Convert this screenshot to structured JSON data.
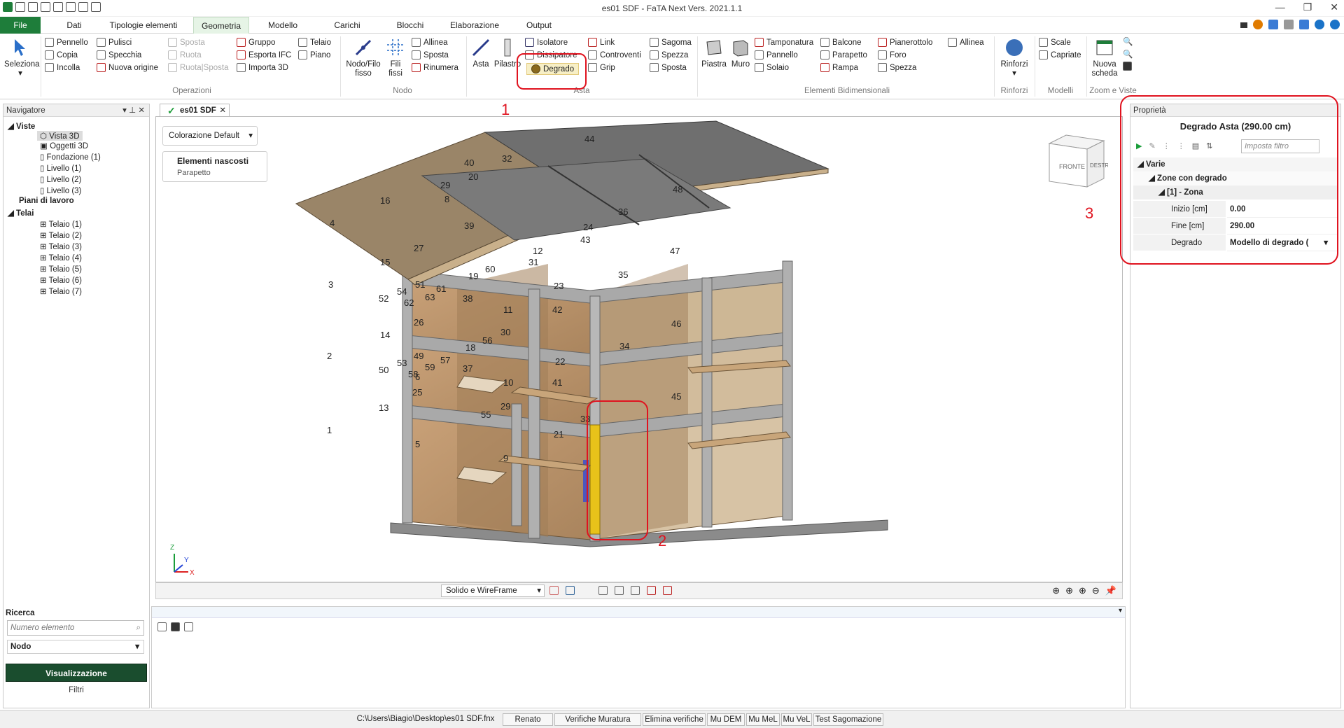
{
  "window": {
    "title": "es01 SDF - FaTA Next Vers. 2021.1.1"
  },
  "tabs": [
    "File",
    "Dati",
    "Tipologie elementi",
    "Geometria",
    "Modello",
    "Carichi",
    "Blocchi",
    "Elaborazione",
    "Output"
  ],
  "ribbon": {
    "seleziona": "Seleziona",
    "operazioni": {
      "pennello": "Pennello",
      "copia": "Copia",
      "incolla": "Incolla",
      "pulisci": "Pulisci",
      "specchia": "Specchia",
      "nuova_origine": "Nuova origine",
      "sposta": "Sposta",
      "ruota": "Ruota",
      "ruota_sposta": "Ruota|Sposta",
      "gruppo": "Gruppo",
      "esporta_ifc": "Esporta IFC",
      "importa_3d": "Importa 3D",
      "telaio": "Telaio",
      "piano": "Piano",
      "label": "Operazioni"
    },
    "nodo": {
      "nodo_filo_1": "Nodo/Filo",
      "nodo_filo_2": "fisso",
      "fili_1": "Fili",
      "fili_2": "fissi",
      "allinea": "Allinea",
      "sposta": "Sposta",
      "rinumera": "Rinumera",
      "label": "Nodo"
    },
    "asta": {
      "asta": "Asta",
      "pilastro": "Pilastro",
      "isolatore": "Isolatore",
      "dissipatore": "Dissipatore",
      "degrado": "Degrado",
      "link": "Link",
      "controventi": "Controventi",
      "grip": "Grip",
      "sagoma": "Sagoma",
      "spezza": "Spezza",
      "sposta": "Sposta",
      "label": "Asta"
    },
    "elementi": {
      "piastra": "Piastra",
      "muro": "Muro",
      "tamponatura": "Tamponatura",
      "pannello": "Pannello",
      "solaio": "Solaio",
      "balcone": "Balcone",
      "parapetto": "Parapetto",
      "rampa": "Rampa",
      "pianerottolo": "Pianerottolo",
      "foro": "Foro",
      "spezza": "Spezza",
      "allinea": "Allinea",
      "label": "Elementi Bidimensionali"
    },
    "rinforzi": {
      "rinforzi": "Rinforzi",
      "label": "Rinforzi"
    },
    "modelli": {
      "scale": "Scale",
      "capriate": "Capriate",
      "label": "Modelli"
    },
    "zoom": {
      "nuova_1": "Nuova",
      "nuova_2": "scheda",
      "label": "Zoom e Viste"
    }
  },
  "navigator": {
    "title": "Navigatore",
    "viste": "Viste",
    "viste_items": [
      "Vista 3D",
      "Oggetti 3D",
      "Fondazione (1)",
      "Livello (1)",
      "Livello (2)",
      "Livello (3)"
    ],
    "piani": "Piani di lavoro",
    "telai": "Telai",
    "telai_items": [
      "Telaio (1)",
      "Telaio (2)",
      "Telaio (3)",
      "Telaio (4)",
      "Telaio (5)",
      "Telaio (6)",
      "Telaio (7)"
    ],
    "ricerca": "Ricerca",
    "search_placeholder": "Numero elemento",
    "search_type": "Nodo",
    "visualizzazione": "Visualizzazione",
    "filtri": "Filtri"
  },
  "document": {
    "tab": "es01 SDF",
    "colorazione": "Colorazione Default",
    "hidden_title": "Elementi nascosti",
    "hidden_item": "Parapetto",
    "view_mode": "Solido e WireFrame",
    "cube_front": "FRONTE",
    "cube_right": "DESTRA",
    "axis_x": "X",
    "axis_y": "Y",
    "axis_z": "Z"
  },
  "node_labels": [
    "44",
    "40",
    "32",
    "20",
    "29",
    "8",
    "16",
    "48",
    "36",
    "39",
    "24",
    "43",
    "4",
    "12",
    "47",
    "27",
    "31",
    "15",
    "60",
    "19",
    "35",
    "3",
    "51",
    "61",
    "54",
    "63",
    "52",
    "62",
    "38",
    "23",
    "11",
    "42",
    "26",
    "30",
    "14",
    "56",
    "18",
    "46",
    "34",
    "2",
    "49",
    "57",
    "53",
    "59",
    "37",
    "22",
    "50",
    "58",
    "6",
    "10",
    "41",
    "25",
    "45",
    "13",
    "29",
    "55",
    "33",
    "1",
    "21",
    "5",
    "9"
  ],
  "properties": {
    "title": "Proprietà",
    "header": "Degrado Asta (290.00 cm)",
    "filter_placeholder": "Imposta filtro",
    "varie": "Varie",
    "zone": "Zone con degrado",
    "zona": "[1] - Zona",
    "inizio_label": "Inizio",
    "inizio_unit": "[cm]",
    "inizio_value": "0.00",
    "fine_label": "Fine",
    "fine_unit": "[cm]",
    "fine_value": "290.00",
    "degrado_label": "Degrado",
    "degrado_value": "Modello di degrado ("
  },
  "annotations": [
    "1",
    "2",
    "3"
  ],
  "status": {
    "path": "C:\\Users\\Biagio\\Desktop\\es01 SDF.fnx",
    "user": "Renato",
    "items": [
      "Verifiche Muratura",
      "Elimina verifiche",
      "Mu DEM",
      "Mu MeL",
      "Mu VeL",
      "Test Sagomazione"
    ]
  },
  "colors": {
    "accent": "#1e7d3a",
    "annotation": "#e0131f",
    "highlight": "#e8c21a"
  }
}
